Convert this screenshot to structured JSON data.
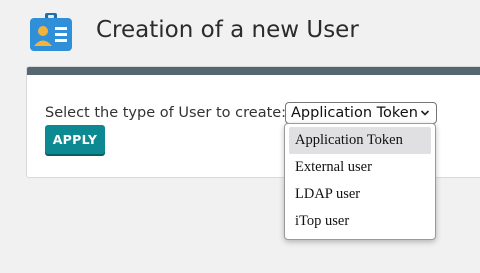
{
  "header": {
    "title": "Creation of a new User",
    "icon": "user-badge-icon"
  },
  "form": {
    "type_label": "Select the type of User to create:",
    "select": {
      "selected": "Application Token",
      "options": [
        "Application Token",
        "External user",
        "LDAP user",
        "iTop user"
      ]
    },
    "apply_label": "APPLY"
  },
  "colors": {
    "accent": "#0d8a91",
    "card_bar": "#56686f",
    "badge_icon": "#2f8fd8"
  }
}
